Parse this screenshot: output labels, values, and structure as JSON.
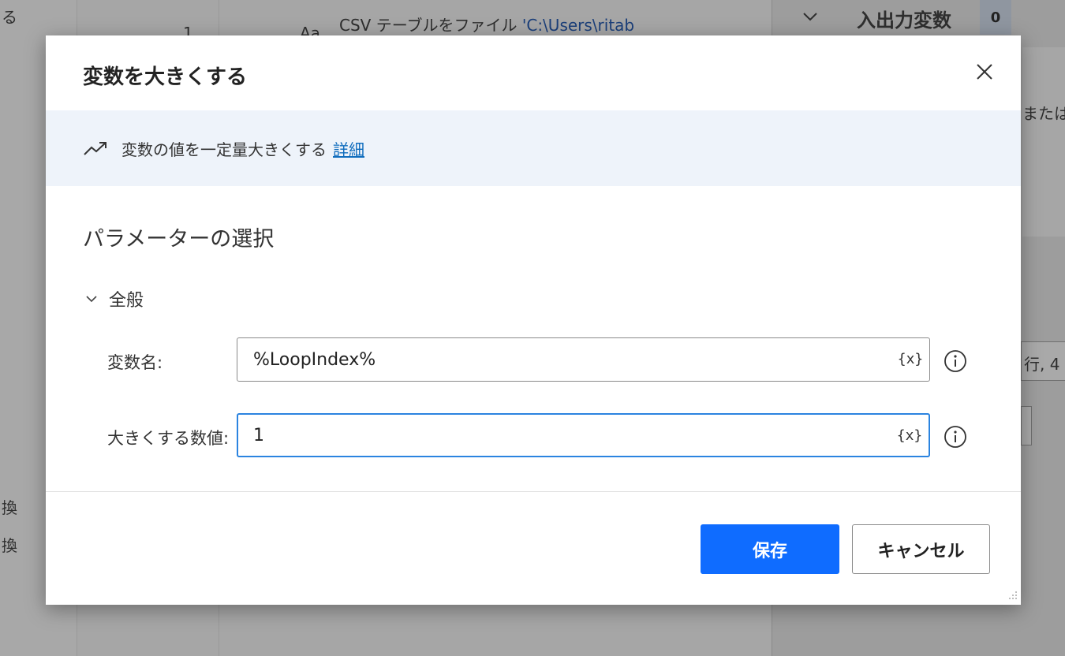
{
  "background": {
    "top_left_fragment": "る",
    "row_number": "1",
    "row_icon_text": "Aa",
    "action_description": "CSV テーブルをファイル",
    "action_path": "'C:\\Users\\ritab",
    "panel_title": "入出力変数",
    "panel_count": "0",
    "panel_text_fragment": "または",
    "panel_row_fragment": "行, 4",
    "left_fragment_1": "換",
    "left_fragment_2": "換"
  },
  "dialog": {
    "title": "変数を大きくする",
    "close_icon": "close-icon",
    "banner": {
      "icon": "trending-up-icon",
      "text": "変数の値を一定量大きくする",
      "link": "詳細"
    },
    "section_title": "パラメーターの選択",
    "group": {
      "label": "全般",
      "expanded": true
    },
    "fields": {
      "variable_name": {
        "label": "変数名:",
        "value": "%LoopIndex%",
        "var_button": "{x}"
      },
      "increase_by": {
        "label": "大きくする数値:",
        "value": "1",
        "var_button": "{x}"
      }
    },
    "buttons": {
      "save": "保存",
      "cancel": "キャンセル"
    }
  },
  "colors": {
    "primary": "#0f6cff",
    "link": "#0f6cbd",
    "banner_bg": "#eef3fa",
    "focus_border": "#2b84e0"
  }
}
